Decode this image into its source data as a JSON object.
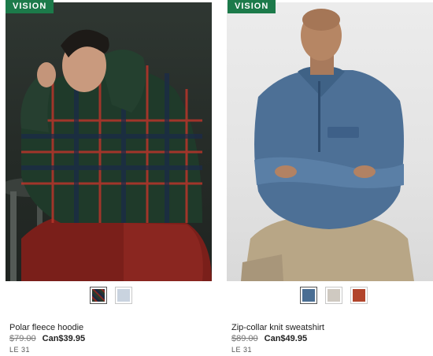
{
  "products": [
    {
      "badge": "VISION",
      "title": "Polar fleece hoodie",
      "old_price": "$79.00",
      "new_price": "Can$39.95",
      "sku": "LE 31",
      "swatches": [
        {
          "name": "plaid",
          "color": "#5a2a22",
          "selected": true
        },
        {
          "name": "light-blue",
          "color": "#c9d3df",
          "selected": false
        }
      ]
    },
    {
      "badge": "VISION",
      "title": "Zip-collar knit sweatshirt",
      "old_price": "$89.00",
      "new_price": "Can$49.95",
      "sku": "LE 31",
      "swatches": [
        {
          "name": "blue",
          "color": "#4a6e93",
          "selected": true
        },
        {
          "name": "oatmeal",
          "color": "#cfc9c1",
          "selected": false
        },
        {
          "name": "rust",
          "color": "#b2452c",
          "selected": false
        }
      ]
    }
  ],
  "colors": {
    "badge_bg": "#1c7a4a",
    "price_strike": "#777777"
  }
}
